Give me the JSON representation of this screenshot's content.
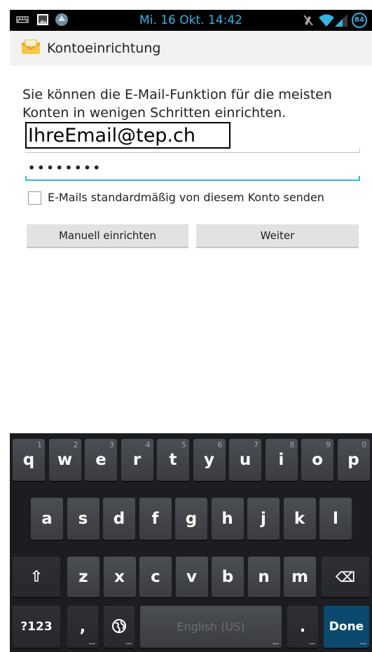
{
  "status_bar": {
    "time": "Mi. 16 Okt. 14:42",
    "battery": "84",
    "icons": [
      "keyboard-icon",
      "image-icon",
      "app-icon",
      "mute-icon",
      "wifi-icon",
      "signal-icon",
      "battery-icon"
    ],
    "accent_color": "#33b5e5"
  },
  "title_bar": {
    "title": "Kontoeinrichtung",
    "icon": "mail-envelope-icon"
  },
  "form": {
    "description": "Sie können die E-Mail-Funktion für die meisten Konten in wenigen Schritten einrichten.",
    "email_value": "IhreEmail@tep.ch",
    "password_value": "••••••••",
    "default_send_label": "E-Mails standardmäßig von diesem Konto senden",
    "default_send_checked": false,
    "manual_button": "Manuell einrichten",
    "next_button": "Weiter"
  },
  "keyboard": {
    "row1": [
      {
        "k": "q",
        "n": "1"
      },
      {
        "k": "w",
        "n": "2"
      },
      {
        "k": "e",
        "n": "3"
      },
      {
        "k": "r",
        "n": "4"
      },
      {
        "k": "t",
        "n": "5"
      },
      {
        "k": "y",
        "n": "6"
      },
      {
        "k": "u",
        "n": "7"
      },
      {
        "k": "i",
        "n": "8"
      },
      {
        "k": "o",
        "n": "9"
      },
      {
        "k": "p",
        "n": "0"
      }
    ],
    "row2": [
      "a",
      "s",
      "d",
      "f",
      "g",
      "h",
      "j",
      "k",
      "l"
    ],
    "row3": [
      "z",
      "x",
      "c",
      "v",
      "b",
      "n",
      "m"
    ],
    "shift": "⇧",
    "backspace": "⌫",
    "symbols": "?123",
    "comma": ",",
    "globe": "🌐",
    "space": "English (US)",
    "period": ".",
    "done": "Done",
    "done_color": "#0b4a6e"
  }
}
